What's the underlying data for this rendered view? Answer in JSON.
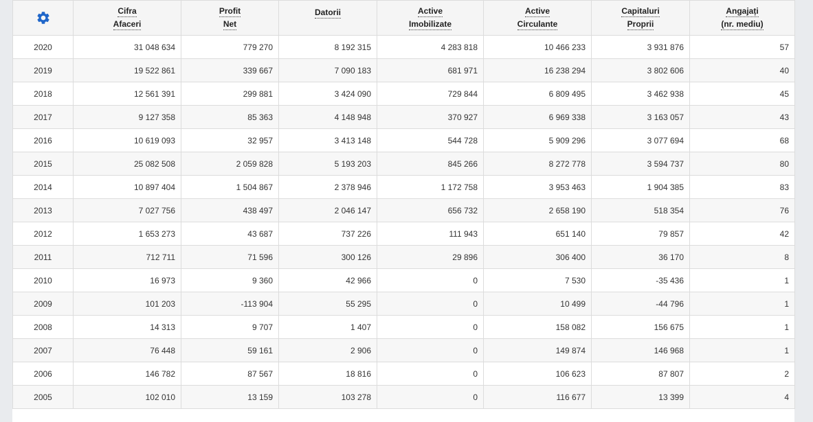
{
  "table": {
    "settings_icon": "gear-icon",
    "accent_color": "#1f66c9",
    "headers": [
      [
        "Cifra",
        "Afaceri"
      ],
      [
        "Profit",
        "Net"
      ],
      [
        "Datorii"
      ],
      [
        "Active",
        "Imobilizate"
      ],
      [
        "Active",
        "Circulante"
      ],
      [
        "Capitaluri",
        "Proprii"
      ],
      [
        "Angajați",
        "(nr. mediu)"
      ]
    ],
    "rows": [
      [
        "2020",
        "31 048 634",
        "779 270",
        "8 192 315",
        "4 283 818",
        "10 466 233",
        "3 931 876",
        "57"
      ],
      [
        "2019",
        "19 522 861",
        "339 667",
        "7 090 183",
        "681 971",
        "16 238 294",
        "3 802 606",
        "40"
      ],
      [
        "2018",
        "12 561 391",
        "299 881",
        "3 424 090",
        "729 844",
        "6 809 495",
        "3 462 938",
        "45"
      ],
      [
        "2017",
        "9 127 358",
        "85 363",
        "4 148 948",
        "370 927",
        "6 969 338",
        "3 163 057",
        "43"
      ],
      [
        "2016",
        "10 619 093",
        "32 957",
        "3 413 148",
        "544 728",
        "5 909 296",
        "3 077 694",
        "68"
      ],
      [
        "2015",
        "25 082 508",
        "2 059 828",
        "5 193 203",
        "845 266",
        "8 272 778",
        "3 594 737",
        "80"
      ],
      [
        "2014",
        "10 897 404",
        "1 504 867",
        "2 378 946",
        "1 172 758",
        "3 953 463",
        "1 904 385",
        "83"
      ],
      [
        "2013",
        "7 027 756",
        "438 497",
        "2 046 147",
        "656 732",
        "2 658 190",
        "518 354",
        "76"
      ],
      [
        "2012",
        "1 653 273",
        "43 687",
        "737 226",
        "111 943",
        "651 140",
        "79 857",
        "42"
      ],
      [
        "2011",
        "712 711",
        "71 596",
        "300 126",
        "29 896",
        "306 400",
        "36 170",
        "8"
      ],
      [
        "2010",
        "16 973",
        "9 360",
        "42 966",
        "0",
        "7 530",
        "-35 436",
        "1"
      ],
      [
        "2009",
        "101 203",
        "-113 904",
        "55 295",
        "0",
        "10 499",
        "-44 796",
        "1"
      ],
      [
        "2008",
        "14 313",
        "9 707",
        "1 407",
        "0",
        "158 082",
        "156 675",
        "1"
      ],
      [
        "2007",
        "76 448",
        "59 161",
        "2 906",
        "0",
        "149 874",
        "146 968",
        "1"
      ],
      [
        "2006",
        "146 782",
        "87 567",
        "18 816",
        "0",
        "106 623",
        "87 807",
        "2"
      ],
      [
        "2005",
        "102 010",
        "13 159",
        "103 278",
        "0",
        "116 677",
        "13 399",
        "4"
      ]
    ]
  }
}
